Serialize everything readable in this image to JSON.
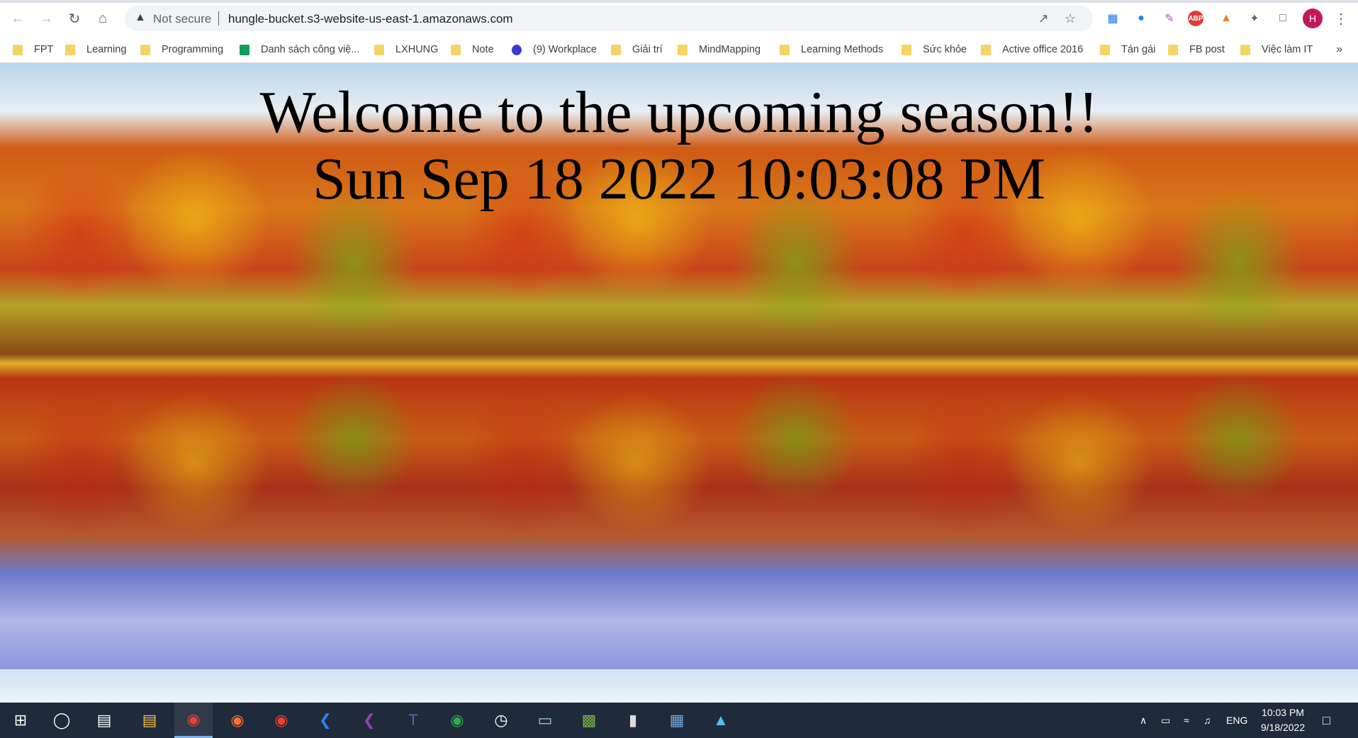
{
  "browser": {
    "security_label": "Not secure",
    "url": "hungle-bucket.s3-website-us-east-1.amazonaws.com",
    "profile_initial": "H",
    "bookmarks": [
      {
        "label": "FPT",
        "type": "folder"
      },
      {
        "label": "Learning",
        "type": "folder"
      },
      {
        "label": "Programming",
        "type": "folder"
      },
      {
        "label": "Danh sách công việ...",
        "type": "sheet"
      },
      {
        "label": "LXHUNG",
        "type": "folder"
      },
      {
        "label": "Note",
        "type": "folder"
      },
      {
        "label": "(9) Workplace",
        "type": "workplace"
      },
      {
        "label": "Giải trí",
        "type": "folder"
      },
      {
        "label": "MindMapping",
        "type": "folder"
      },
      {
        "label": "Learning Methods",
        "type": "folder"
      },
      {
        "label": "Sức khỏe",
        "type": "folder"
      },
      {
        "label": "Active office 2016",
        "type": "folder"
      },
      {
        "label": "Tán gái",
        "type": "folder"
      },
      {
        "label": "FB post",
        "type": "folder"
      },
      {
        "label": "Việc làm IT",
        "type": "folder"
      }
    ],
    "more_label": "»"
  },
  "page": {
    "heading": "Welcome to the upcoming season!!",
    "datetime": "Sun Sep 18 2022 10:03:08 PM"
  },
  "taskbar": {
    "language": "ENG",
    "time": "10:03 PM",
    "date": "9/18/2022"
  }
}
